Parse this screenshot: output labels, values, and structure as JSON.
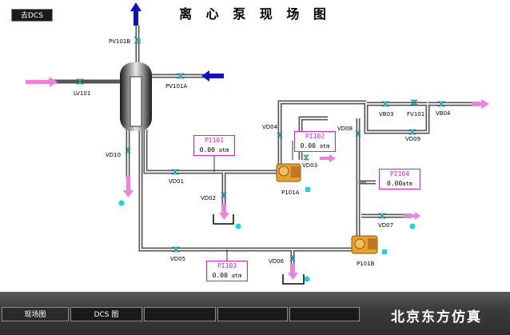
{
  "title": "离 心 泵 现 场 图",
  "dcs_button": "去DCS",
  "valves": {
    "pv101b": "PV101B",
    "pv101a": "PV101A",
    "lv101": "LV101",
    "vd10": "VD10",
    "vd01": "VD01",
    "vd02": "VD02",
    "vd03": "VD03",
    "vd04": "VD04",
    "vd05": "VD05",
    "vd06": "VD06",
    "vd07": "VD07",
    "vd08": "VD08",
    "vd09": "VD09",
    "vb03": "VB03",
    "vb04": "VB04",
    "fv101": "FV101"
  },
  "pumps": {
    "a": "P101A",
    "b": "P101B"
  },
  "gauges": {
    "pi101": {
      "name": "PI101",
      "value": "0.00",
      "unit": "atm"
    },
    "pi102": {
      "name": "PI102",
      "value": "0.00",
      "unit": "atm"
    },
    "pi103": {
      "name": "PI103",
      "value": "0.00",
      "unit": "atm"
    },
    "pi104": {
      "name": "PI104",
      "value": "0.00",
      "unit": "atm"
    }
  },
  "tabs": {
    "field": "现场图",
    "dcs": "DCS 图"
  },
  "brand": "北京东方仿真",
  "colors": {
    "pipe": "#6a6a6a",
    "pink": "#f080e0",
    "blue": "#1010c0",
    "valve": "#40d0e0",
    "gauge_border": "#d020d0"
  }
}
